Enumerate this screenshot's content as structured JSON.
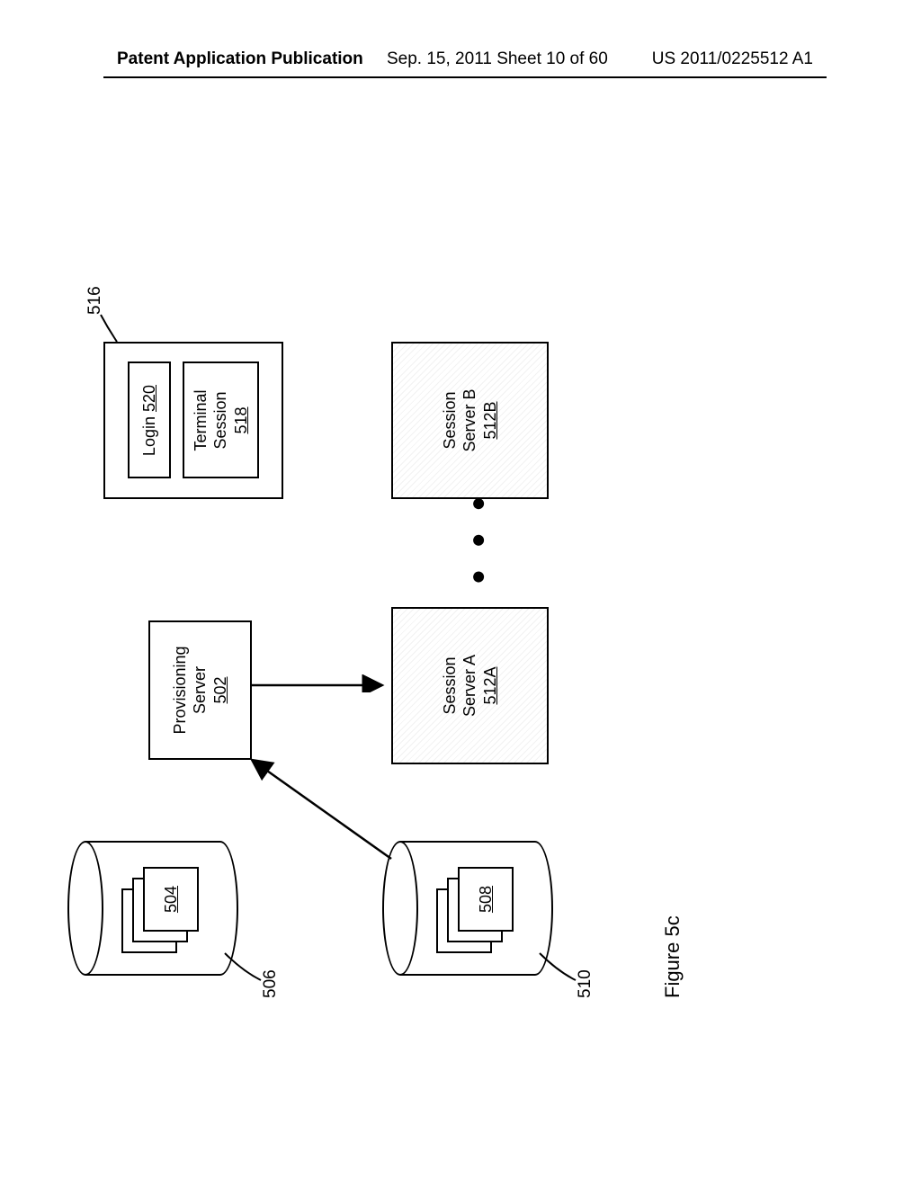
{
  "header": {
    "left": "Patent Application Publication",
    "center": "Sep. 15, 2011  Sheet 10 of 60",
    "right": "US 2011/0225512 A1"
  },
  "cylinders": {
    "cyl1": {
      "callout": "506",
      "stack_ref": "504"
    },
    "cyl2": {
      "callout": "510",
      "stack_ref": "508"
    }
  },
  "provisioning": {
    "label": "Provisioning\nServer",
    "ref": "502"
  },
  "client": {
    "callout": "516",
    "login_label": "Login",
    "login_ref": "520",
    "ts_label": "Terminal\nSession",
    "ts_ref": "518"
  },
  "sessions": {
    "a": {
      "label": "Session\nServer A",
      "ref": "512A"
    },
    "b": {
      "label": "Session\nServer B",
      "ref": "512B"
    }
  },
  "dots": "● ● ●",
  "figure_label": "Figure 5c"
}
